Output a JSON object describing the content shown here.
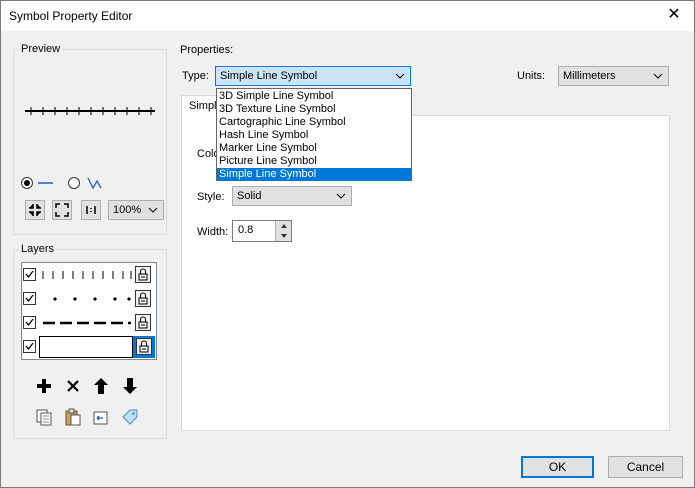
{
  "window": {
    "title": "Symbol Property Editor"
  },
  "preview": {
    "group_label": "Preview",
    "zoom": "100%"
  },
  "layers": {
    "group_label": "Layers"
  },
  "properties": {
    "group_label": "Properties:",
    "type_label": "Type:",
    "type_value": "Simple Line Symbol",
    "units_label": "Units:",
    "units_value": "Millimeters",
    "tab_label": "Simple",
    "color_label": "Colo",
    "style_label": "Style:",
    "style_value": "Solid",
    "width_label": "Width:",
    "width_value": "0.8"
  },
  "type_options": [
    "3D Simple Line Symbol",
    "3D Texture Line Symbol",
    "Cartographic Line Symbol",
    "Hash Line Symbol",
    "Marker Line Symbol",
    "Picture Line Symbol",
    "Simple Line Symbol"
  ],
  "buttons": {
    "ok": "OK",
    "cancel": "Cancel"
  },
  "colors": {
    "accent": "#0078d7",
    "selected_text": "#ffffff"
  }
}
